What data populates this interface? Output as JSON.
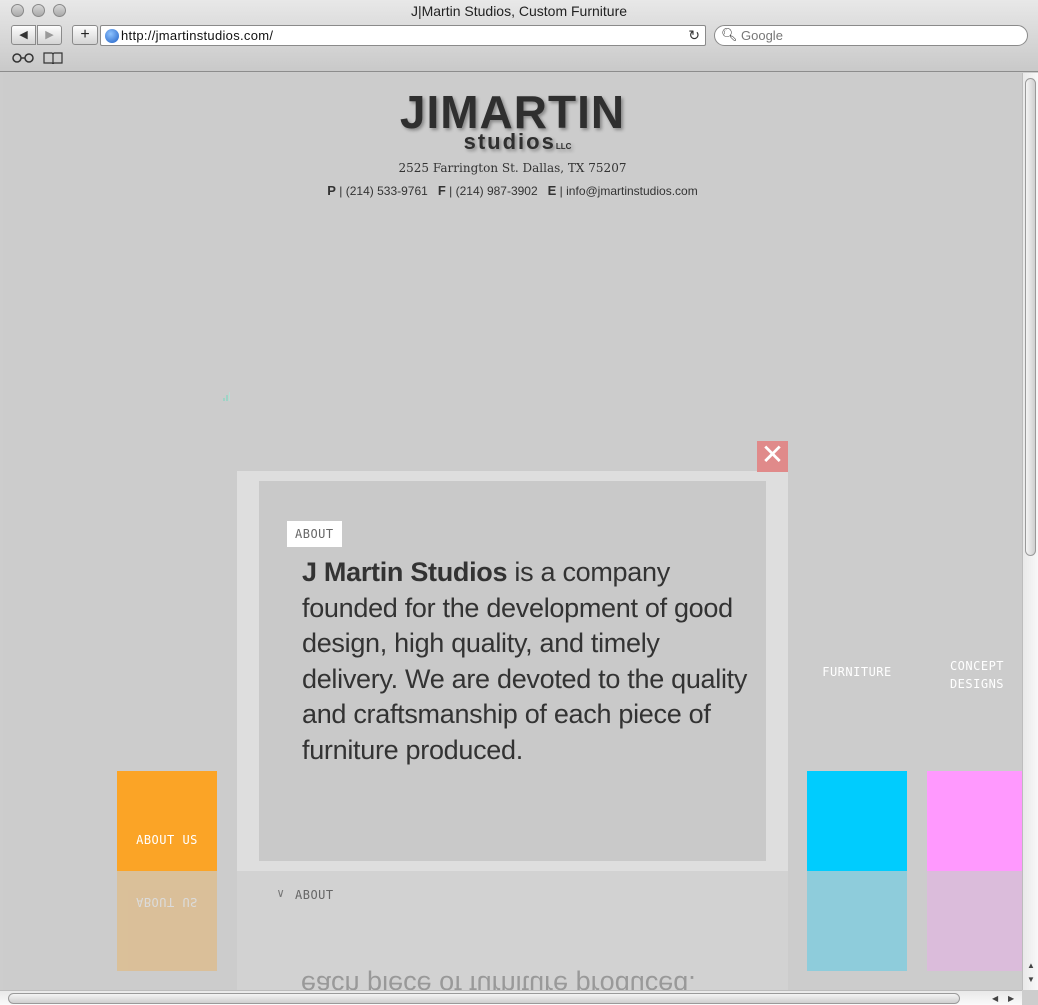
{
  "window": {
    "title": "J|Martin Studios, Custom Furniture",
    "url": "http://jmartinstudios.com/",
    "search_placeholder": "Google"
  },
  "icons": {
    "back": "back-arrow-icon",
    "forward": "forward-arrow-icon",
    "add": "plus-icon",
    "reload": "reload-icon",
    "search": "search-icon",
    "reading": "glasses-icon",
    "bookmarks": "book-icon",
    "close": "close-icon"
  },
  "header": {
    "logo_main": "JIMARTIN",
    "logo_sub": "studios",
    "logo_llc": "LLC",
    "address": "2525 Farrington St. Dallas, TX 75207",
    "phone_label": "P",
    "phone": "(214) 533-9761",
    "fax_label": "F",
    "fax": "(214) 987-3902",
    "email_label": "E",
    "email": "info@jmartinstudios.com"
  },
  "nav": {
    "about_us": "ABOUT US",
    "furniture": "FURNITURE",
    "concept": "CONCEPT",
    "designs": "DESIGNS"
  },
  "colors": {
    "about_tile": "#fba426",
    "furniture_tile": "#00ccfe",
    "concept_tile": "#ff99fe",
    "close_button": "#e08a8a"
  },
  "modal": {
    "tag": "ABOUT",
    "company": "J Martin Studios",
    "body": " is a company founded for the development of good design, high quality, and timely delivery. We are devoted to the quality and craftsmanship of each piece of furniture produced.",
    "fold_label": "ABOUT",
    "mirror_text": "each piece of furniture produced."
  }
}
